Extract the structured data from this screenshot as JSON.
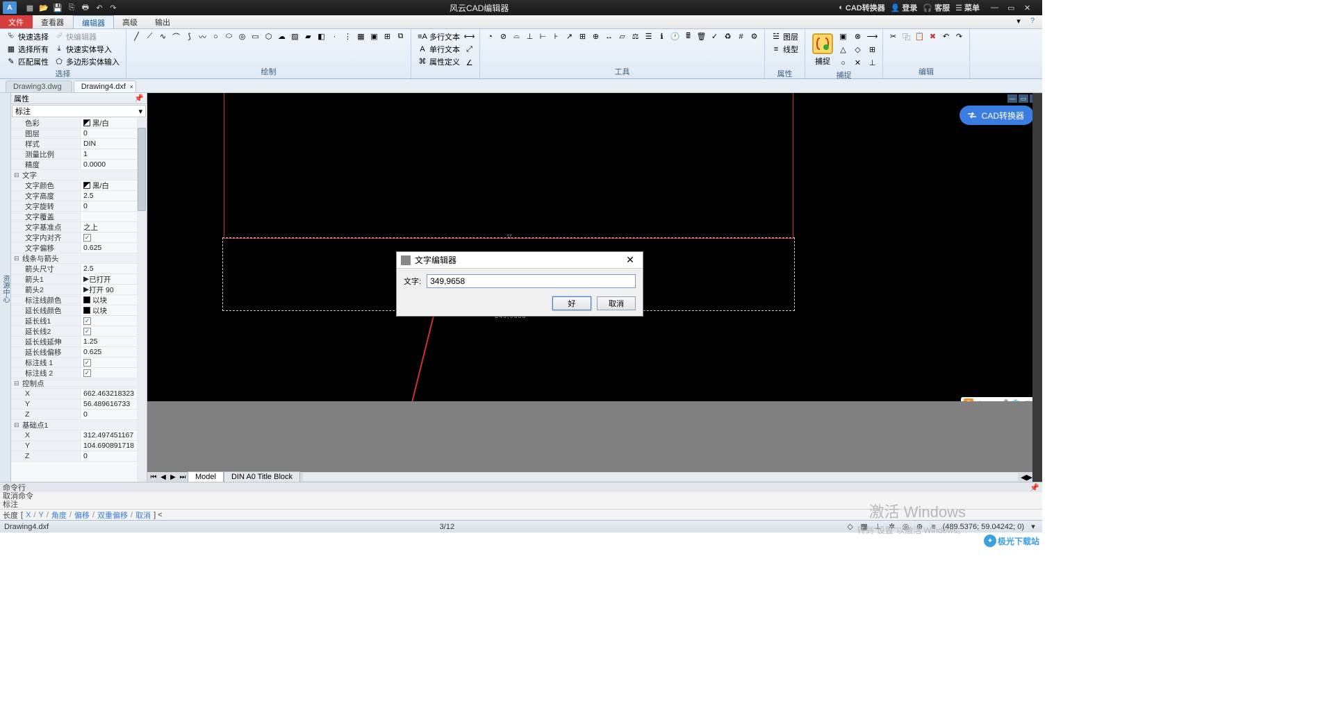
{
  "titlebar": {
    "app_title": "风云CAD编辑器",
    "qat": [
      "new",
      "open",
      "save",
      "saveall",
      "print",
      "undo",
      "redo"
    ],
    "right": {
      "converter": "CAD转换器",
      "login": "登录",
      "service": "客服",
      "menu": "菜单"
    }
  },
  "menutabs": {
    "file": "文件",
    "viewer": "查看器",
    "editor": "编辑器",
    "advanced": "高级",
    "output": "输出"
  },
  "ribbon": {
    "select": {
      "label": "选择",
      "quick_select": "快速选择",
      "select_all": "选择所有",
      "match_prop": "匹配属性",
      "quick_editor": "快编辑器",
      "entity_import": "快速实体导入",
      "poly_entity_input": "多边形实体输入"
    },
    "draw": {
      "label": "绘制"
    },
    "text_group": {
      "mtext": "多行文本",
      "stext": "单行文本",
      "attrdef": "属性定义"
    },
    "tool": {
      "label": "工具"
    },
    "layer": {
      "layer": "图层",
      "linetype": "线型",
      "label": "属性"
    },
    "snap": {
      "big": "捕捉",
      "label": "捕捉"
    },
    "edit": {
      "label": "编辑"
    }
  },
  "doctabs": {
    "tab1": "Drawing3.dwg",
    "tab2": "Drawing4.dxf"
  },
  "proppanel": {
    "title": "属性",
    "combo": "标注",
    "rows": {
      "color_k": "色彩",
      "color_v": "黑/白",
      "layer_k": "图层",
      "layer_v": "0",
      "style_k": "样式",
      "style_v": "DIN",
      "mscale_k": "测量比例",
      "mscale_v": "1",
      "prec_k": "精度",
      "prec_v": "0.0000",
      "cat_text": "文字",
      "tcolor_k": "文字颜色",
      "tcolor_v": "黑/白",
      "theight_k": "文字高度",
      "theight_v": "2.5",
      "trot_k": "文字旋转",
      "trot_v": "0",
      "tover_k": "文字覆盖",
      "tover_v": "",
      "tbase_k": "文字基准点",
      "tbase_v": "之上",
      "talign_k": "文字内对齐",
      "talign_v": "",
      "toff_k": "文字偏移",
      "toff_v": "0.625",
      "cat_arrows": "线条与箭头",
      "asize_k": "箭头尺寸",
      "asize_v": "2.5",
      "a1_k": "箭头1",
      "a1_v": "已打开",
      "a2_k": "箭头2",
      "a2_v": "打开 90",
      "dlc_k": "标注线颜色",
      "dlc_v": "以块",
      "elc_k": "延长线颜色",
      "elc_v": "以块",
      "el1_k": "延长线1",
      "el2_k": "延长线2",
      "elext_k": "延长线延伸",
      "elext_v": "1.25",
      "eloff_k": "延长线偏移",
      "eloff_v": "0.625",
      "dl1_k": "标注线 1",
      "dl2_k": "标注线 2",
      "cat_ctrl": "控制点",
      "cx_k": "X",
      "cx_v": "662.463218323",
      "cy_k": "Y",
      "cy_v": "56.489616733",
      "cz_k": "Z",
      "cz_v": "0",
      "cat_base": "基础点1",
      "bx_k": "X",
      "bx_v": "312.497451167",
      "by_k": "Y",
      "by_v": "104.690891718",
      "bz_k": "Z",
      "bz_v": "0"
    }
  },
  "canvas": {
    "cad_converter": "CAD转换器",
    "dim_preview": "349,9658",
    "model_tab": "Model",
    "layout_tab": "DIN A0 Title Block"
  },
  "dialog": {
    "title": "文字编辑器",
    "label": "文字:",
    "value": "349,9658",
    "ok": "好",
    "cancel": "取消"
  },
  "cmd": {
    "header": "命令行",
    "line1": "取消命令",
    "line2": "标注",
    "prompt": "长度",
    "seg_x": "X",
    "seg_y": "Y",
    "seg_angle": "角度",
    "seg_offset": "偏移",
    "seg_doffset": "双重偏移",
    "seg_cancel": "取消"
  },
  "status": {
    "file": "Drawing4.dxf",
    "pages": "3/12",
    "coords": "(489.5376; 59.04242; 0)"
  },
  "watermark": {
    "l1": "激活 Windows",
    "l2": "转到\"设置\"以激活 Windows。",
    "site": "极光下载站"
  },
  "colors": {
    "accent": "#3a7de0",
    "red": "#c83030"
  }
}
